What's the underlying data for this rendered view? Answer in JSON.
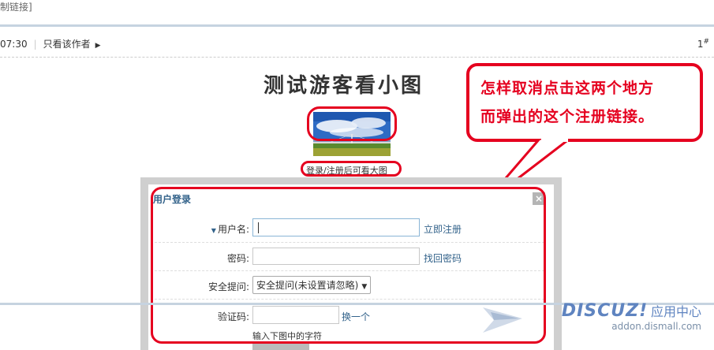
{
  "breadcrumb": {
    "copy_link_fragment": "制链接]"
  },
  "post": {
    "time_fragment": "07:30",
    "only_author_label": "只看该作者",
    "floor": "1",
    "floor_sup": "#",
    "title": "测试游客看小图",
    "thumb_link": "登录/注册后可看大图"
  },
  "annotation": {
    "line1": "怎样取消点击这两个地方",
    "line2": "而弹出的这个注册链接。"
  },
  "dialog": {
    "title": "用户登录",
    "close_glyph": "×",
    "username_label": "用户名:",
    "username_value": "",
    "register_link": "立即注册",
    "password_label": "密码:",
    "password_value": "",
    "forgot_link": "找回密码",
    "question_label": "安全提问:",
    "question_selected": "安全提问(未设置请忽略)",
    "captcha_label": "验证码:",
    "captcha_value": "",
    "refresh_link": "换一个",
    "captcha_hint": "输入下图中的字符"
  },
  "watermark": {
    "brand": "DISCUZ!",
    "subtitle": "应用中心",
    "url": "addon.dismall.com"
  },
  "colors": {
    "annotation_red": "#e5001f",
    "link_blue": "#32628a"
  }
}
